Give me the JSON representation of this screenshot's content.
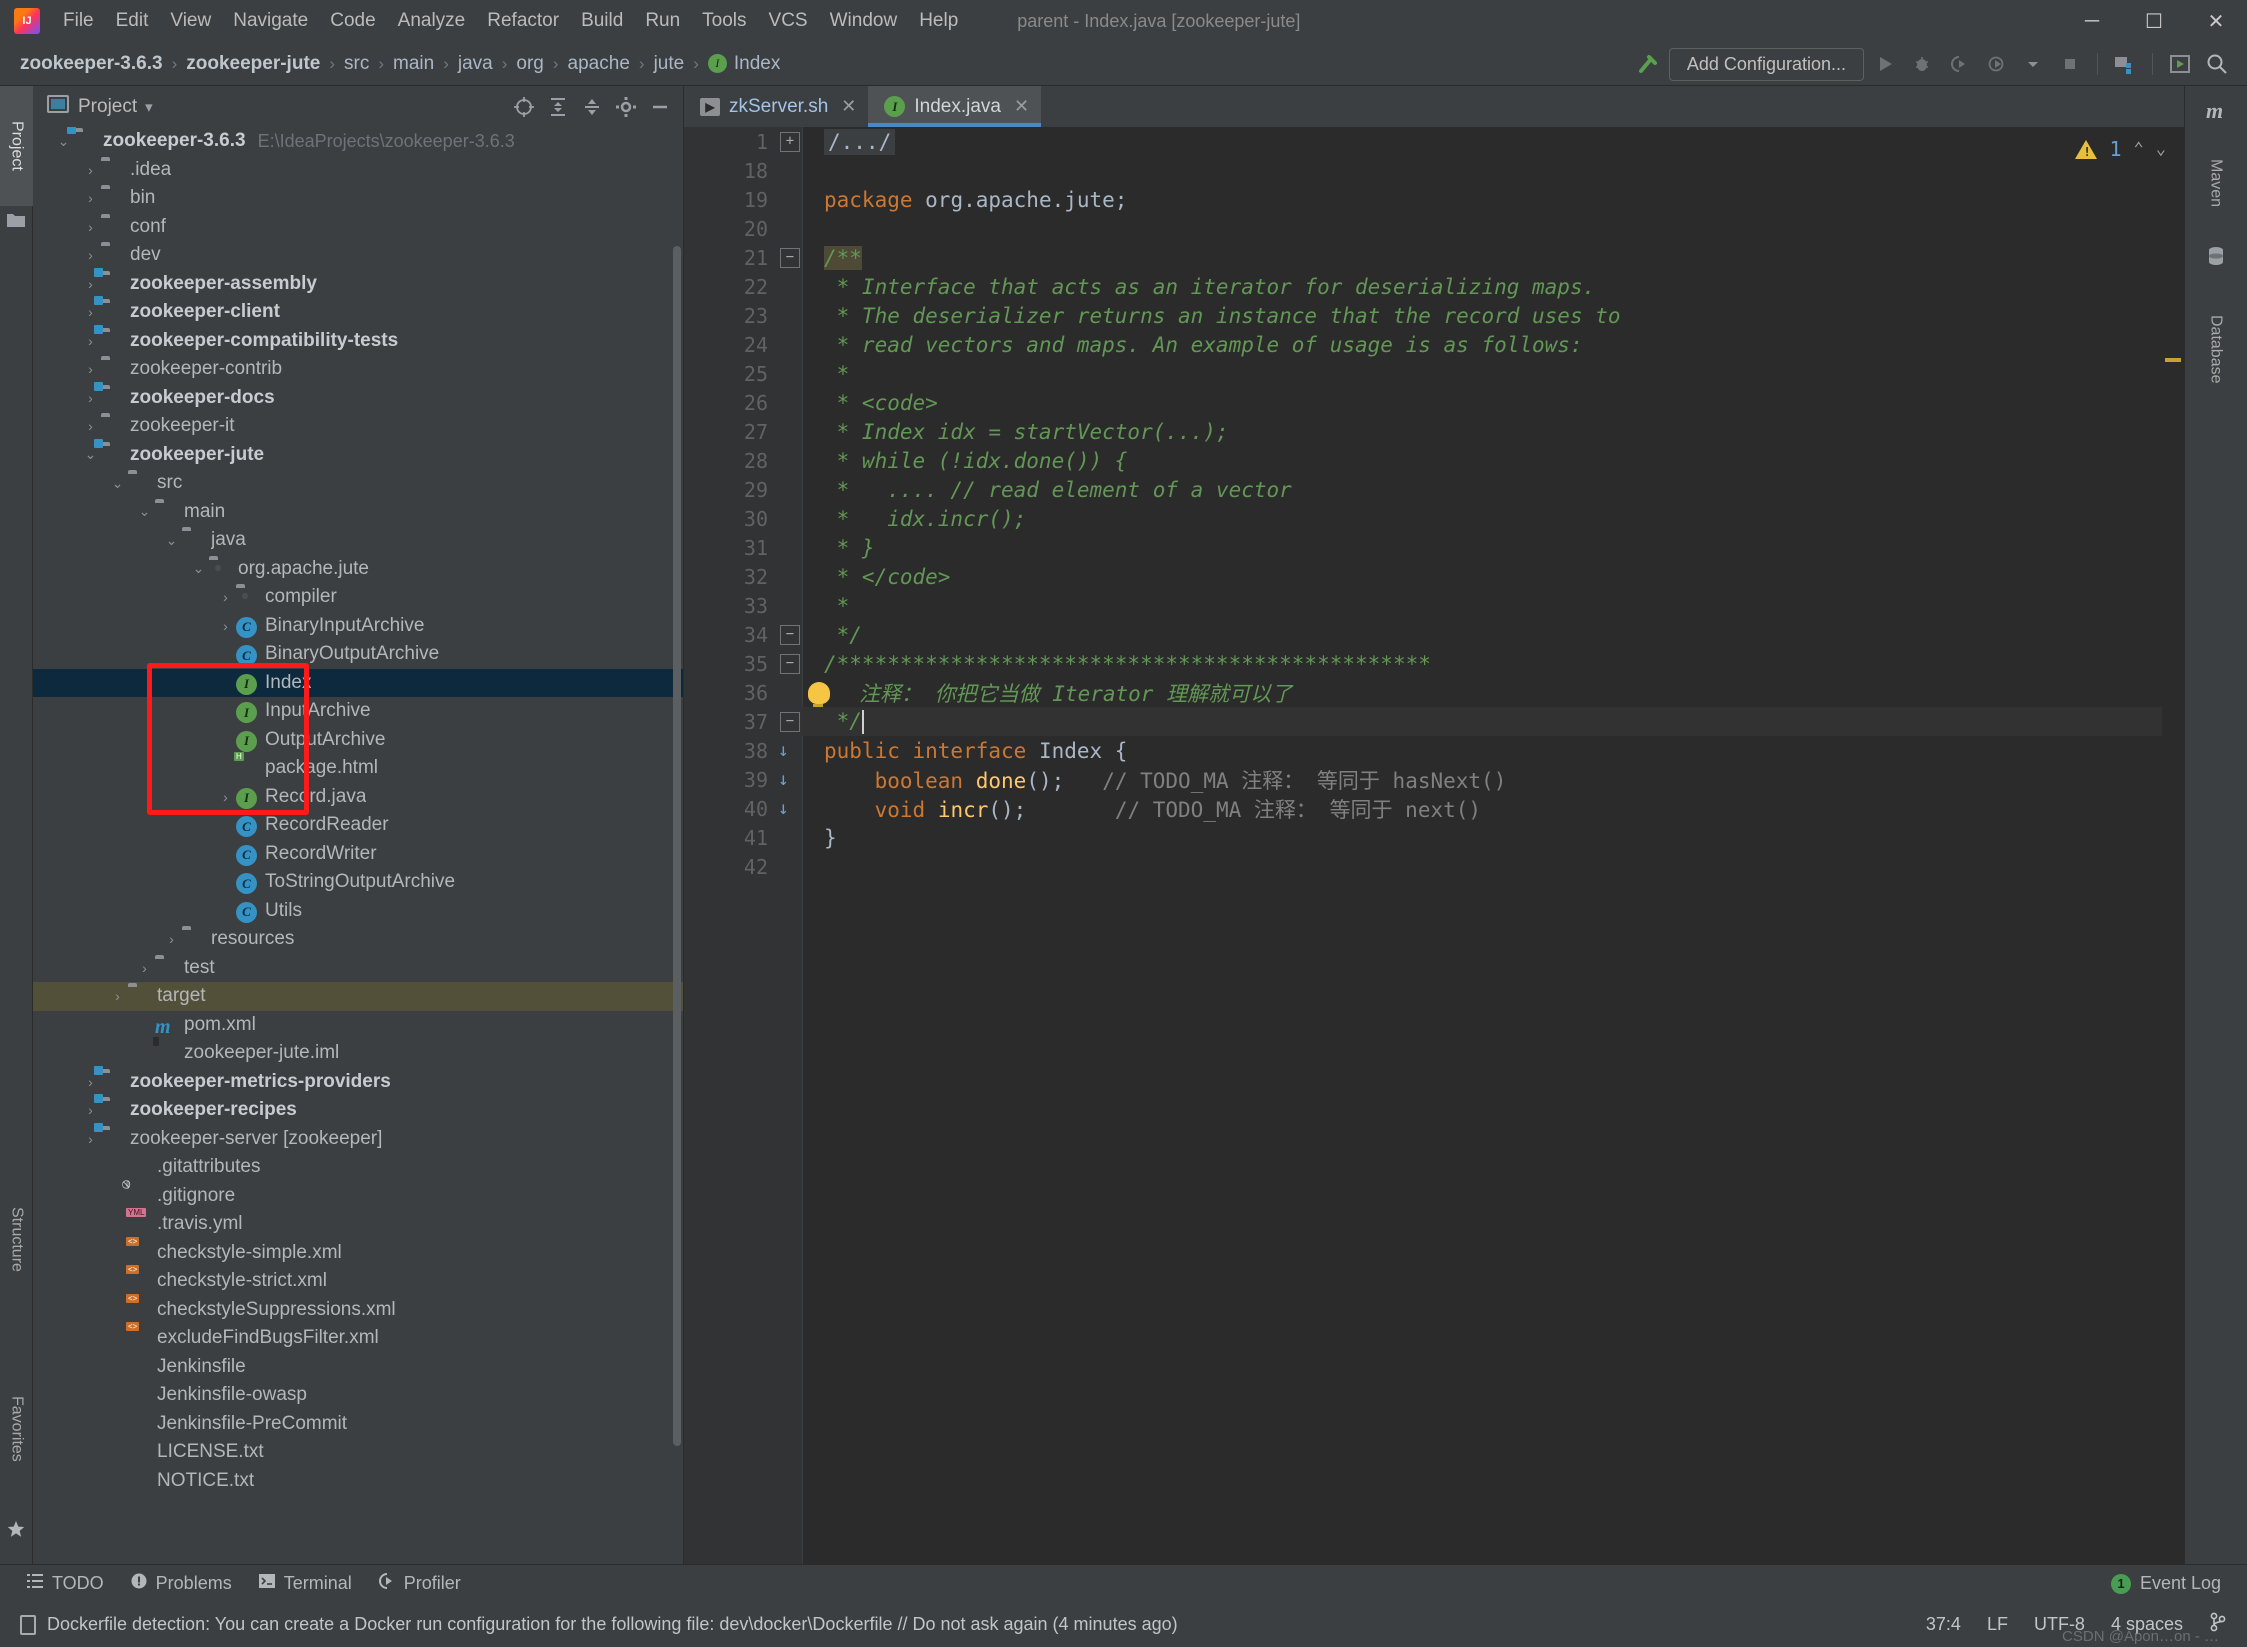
{
  "window": {
    "title": "parent - Index.java [zookeeper-jute]",
    "minimize": "─",
    "maximize": "☐",
    "close": "✕"
  },
  "menubar": {
    "items": [
      "File",
      "Edit",
      "View",
      "Navigate",
      "Code",
      "Analyze",
      "Refactor",
      "Build",
      "Run",
      "Tools",
      "VCS",
      "Window",
      "Help"
    ]
  },
  "breadcrumb": {
    "items": [
      {
        "label": "zookeeper-3.6.3",
        "bold": true,
        "icon": ""
      },
      {
        "label": "zookeeper-jute",
        "bold": true,
        "icon": ""
      },
      {
        "label": "src",
        "bold": false,
        "icon": ""
      },
      {
        "label": "main",
        "bold": false,
        "icon": ""
      },
      {
        "label": "java",
        "bold": false,
        "icon": ""
      },
      {
        "label": "org",
        "bold": false,
        "icon": ""
      },
      {
        "label": "apache",
        "bold": false,
        "icon": ""
      },
      {
        "label": "jute",
        "bold": false,
        "icon": ""
      },
      {
        "label": "Index",
        "bold": false,
        "icon": "interface-icon"
      }
    ],
    "separator": "›"
  },
  "toolbar": {
    "build_icon": "hammer-icon",
    "add_configuration": "Add Configuration...",
    "run_icon": "run-icon",
    "debug_icon": "debug-icon",
    "run_coverage_icon": "run-with-coverage-icon",
    "profile_icon": "profile-icon",
    "dropdown_icon": "chevron-down-icon",
    "stop_icon": "stop-icon",
    "project_structure_icon": "project-structure-icon",
    "update_icon": "update-icon",
    "search_icon": "search-icon"
  },
  "left_strip": {
    "tabs": [
      {
        "label": "Project",
        "selected": true,
        "icon": "project-icon"
      },
      {
        "label": "Structure",
        "selected": false,
        "icon": "structure-icon"
      },
      {
        "label": "Favorites",
        "selected": false,
        "icon": "star-icon"
      }
    ]
  },
  "right_strip": {
    "tabs": [
      {
        "label": "Maven",
        "icon": "maven-icon"
      },
      {
        "label": "Database",
        "icon": "database-icon"
      }
    ]
  },
  "project_panel": {
    "title": "Project",
    "title_dropdown": "▾",
    "header_icons": [
      "locate-icon",
      "expand-all-icon",
      "collapse-all-icon",
      "settings-gear-icon",
      "hide-icon"
    ],
    "tree": [
      {
        "depth": 0,
        "arrow": "down",
        "icon": "folder-module",
        "label": "zookeeper-3.6.3",
        "bold": true,
        "sub": "E:\\IdeaProjects\\zookeeper-3.6.3"
      },
      {
        "depth": 1,
        "arrow": "right",
        "icon": "folder",
        "label": ".idea",
        "bold": false
      },
      {
        "depth": 1,
        "arrow": "right",
        "icon": "folder",
        "label": "bin",
        "bold": false
      },
      {
        "depth": 1,
        "arrow": "right",
        "icon": "folder",
        "label": "conf",
        "bold": false
      },
      {
        "depth": 1,
        "arrow": "right",
        "icon": "folder",
        "label": "dev",
        "bold": false
      },
      {
        "depth": 1,
        "arrow": "right",
        "icon": "folder-module",
        "label": "zookeeper-assembly",
        "bold": true
      },
      {
        "depth": 1,
        "arrow": "right",
        "icon": "folder-module",
        "label": "zookeeper-client",
        "bold": true
      },
      {
        "depth": 1,
        "arrow": "right",
        "icon": "folder-module",
        "label": "zookeeper-compatibility-tests",
        "bold": true
      },
      {
        "depth": 1,
        "arrow": "right",
        "icon": "folder",
        "label": "zookeeper-contrib",
        "bold": false
      },
      {
        "depth": 1,
        "arrow": "right",
        "icon": "folder-module",
        "label": "zookeeper-docs",
        "bold": true
      },
      {
        "depth": 1,
        "arrow": "right",
        "icon": "folder",
        "label": "zookeeper-it",
        "bold": false
      },
      {
        "depth": 1,
        "arrow": "down",
        "icon": "folder-module",
        "label": "zookeeper-jute",
        "bold": true
      },
      {
        "depth": 2,
        "arrow": "down",
        "icon": "folder",
        "label": "src",
        "bold": false
      },
      {
        "depth": 3,
        "arrow": "down",
        "icon": "folder",
        "label": "main",
        "bold": false
      },
      {
        "depth": 4,
        "arrow": "down",
        "icon": "folder-source",
        "label": "java",
        "bold": false
      },
      {
        "depth": 5,
        "arrow": "down",
        "icon": "folder-package",
        "label": "org.apache.jute",
        "bold": false
      },
      {
        "depth": 6,
        "arrow": "right",
        "icon": "folder-package",
        "label": "compiler",
        "bold": false
      },
      {
        "depth": 6,
        "arrow": "right",
        "icon": "class-icon",
        "label": "BinaryInputArchive",
        "bold": false
      },
      {
        "depth": 6,
        "arrow": "none",
        "icon": "class-icon",
        "label": "BinaryOutputArchive",
        "bold": false
      },
      {
        "depth": 6,
        "arrow": "none",
        "icon": "interface-icon",
        "label": "Index",
        "bold": false,
        "selected": true
      },
      {
        "depth": 6,
        "arrow": "none",
        "icon": "interface-icon",
        "label": "InputArchive",
        "bold": false
      },
      {
        "depth": 6,
        "arrow": "none",
        "icon": "interface-icon",
        "label": "OutputArchive",
        "bold": false
      },
      {
        "depth": 6,
        "arrow": "none",
        "icon": "html-file-icon",
        "label": "package.html",
        "bold": false
      },
      {
        "depth": 6,
        "arrow": "right",
        "icon": "interface-icon",
        "label": "Record.java",
        "bold": false
      },
      {
        "depth": 6,
        "arrow": "none",
        "icon": "class-icon",
        "label": "RecordReader",
        "bold": false
      },
      {
        "depth": 6,
        "arrow": "none",
        "icon": "class-icon",
        "label": "RecordWriter",
        "bold": false
      },
      {
        "depth": 6,
        "arrow": "none",
        "icon": "class-icon",
        "label": "ToStringOutputArchive",
        "bold": false
      },
      {
        "depth": 6,
        "arrow": "none",
        "icon": "class-icon",
        "label": "Utils",
        "bold": false
      },
      {
        "depth": 4,
        "arrow": "right",
        "icon": "folder",
        "label": "resources",
        "bold": false
      },
      {
        "depth": 3,
        "arrow": "right",
        "icon": "folder",
        "label": "test",
        "bold": false
      },
      {
        "depth": 2,
        "arrow": "right",
        "icon": "folder-target",
        "label": "target",
        "bold": false,
        "highlight": true
      },
      {
        "depth": 3,
        "arrow": "none",
        "icon": "maven-file-icon",
        "label": "pom.xml",
        "bold": false
      },
      {
        "depth": 3,
        "arrow": "none",
        "icon": "iml-file-icon",
        "label": "zookeeper-jute.iml",
        "bold": false
      },
      {
        "depth": 1,
        "arrow": "right",
        "icon": "folder-module",
        "label": "zookeeper-metrics-providers",
        "bold": true
      },
      {
        "depth": 1,
        "arrow": "right",
        "icon": "folder-module",
        "label": "zookeeper-recipes",
        "bold": true
      },
      {
        "depth": 1,
        "arrow": "right",
        "icon": "folder-module",
        "label": "zookeeper-server [zookeeper]",
        "bold": false
      },
      {
        "depth": 2,
        "arrow": "none",
        "icon": "file-icon",
        "label": ".gitattributes",
        "bold": false
      },
      {
        "depth": 2,
        "arrow": "none",
        "icon": "gitignore-file-icon",
        "label": ".gitignore",
        "bold": false
      },
      {
        "depth": 2,
        "arrow": "none",
        "icon": "yml-file-icon",
        "label": ".travis.yml",
        "bold": false
      },
      {
        "depth": 2,
        "arrow": "none",
        "icon": "xml-file-icon",
        "label": "checkstyle-simple.xml",
        "bold": false
      },
      {
        "depth": 2,
        "arrow": "none",
        "icon": "xml-file-icon",
        "label": "checkstyle-strict.xml",
        "bold": false
      },
      {
        "depth": 2,
        "arrow": "none",
        "icon": "xml-file-icon",
        "label": "checkstyleSuppressions.xml",
        "bold": false
      },
      {
        "depth": 2,
        "arrow": "none",
        "icon": "xml-file-icon",
        "label": "excludeFindBugsFilter.xml",
        "bold": false
      },
      {
        "depth": 2,
        "arrow": "none",
        "icon": "file-icon",
        "label": "Jenkinsfile",
        "bold": false
      },
      {
        "depth": 2,
        "arrow": "none",
        "icon": "file-icon",
        "label": "Jenkinsfile-owasp",
        "bold": false
      },
      {
        "depth": 2,
        "arrow": "none",
        "icon": "file-icon",
        "label": "Jenkinsfile-PreCommit",
        "bold": false
      },
      {
        "depth": 2,
        "arrow": "none",
        "icon": "file-icon",
        "label": "LICENSE.txt",
        "bold": false
      },
      {
        "depth": 2,
        "arrow": "none",
        "icon": "file-icon",
        "label": "NOTICE.txt",
        "bold": false
      }
    ]
  },
  "editor": {
    "tabs": [
      {
        "label": "zkServer.sh",
        "icon": "shell-script-icon",
        "active": false,
        "closable": true
      },
      {
        "label": "Index.java",
        "icon": "interface-icon",
        "active": true,
        "closable": true
      }
    ],
    "close_glyph": "✕",
    "inspection": {
      "warning_count": "1",
      "up_glyph": "⌃",
      "down_glyph": "⌄"
    },
    "lines": [
      {
        "num": "1",
        "fold": "plus",
        "text": "/.../",
        "style": "folded"
      },
      {
        "num": "18",
        "fold": "",
        "text": "",
        "style": "plain"
      },
      {
        "num": "19",
        "fold": "",
        "text": "package org.apache.jute;",
        "style": "package"
      },
      {
        "num": "20",
        "fold": "",
        "text": "",
        "style": "plain"
      },
      {
        "num": "21",
        "fold": "minus-top",
        "text": "/**",
        "style": "comment-open"
      },
      {
        "num": "22",
        "fold": "",
        "text": " * Interface that acts as an iterator for deserializing maps.",
        "style": "comment"
      },
      {
        "num": "23",
        "fold": "",
        "text": " * The deserializer returns an instance that the record uses to",
        "style": "comment"
      },
      {
        "num": "24",
        "fold": "",
        "text": " * read vectors and maps. An example of usage is as follows:",
        "style": "comment"
      },
      {
        "num": "25",
        "fold": "",
        "text": " *",
        "style": "comment"
      },
      {
        "num": "26",
        "fold": "",
        "text": " * <code>",
        "style": "comment"
      },
      {
        "num": "27",
        "fold": "",
        "text": " * Index idx = startVector(...);",
        "style": "comment"
      },
      {
        "num": "28",
        "fold": "",
        "text": " * while (!idx.done()) {",
        "style": "comment"
      },
      {
        "num": "29",
        "fold": "",
        "text": " *   .... // read element of a vector",
        "style": "comment"
      },
      {
        "num": "30",
        "fold": "",
        "text": " *   idx.incr();",
        "style": "comment"
      },
      {
        "num": "31",
        "fold": "",
        "text": " * }",
        "style": "comment"
      },
      {
        "num": "32",
        "fold": "",
        "text": " * </code>",
        "style": "comment"
      },
      {
        "num": "33",
        "fold": "",
        "text": " *",
        "style": "comment"
      },
      {
        "num": "34",
        "fold": "minus-bottom",
        "text": " */",
        "style": "comment"
      },
      {
        "num": "35",
        "fold": "minus-top",
        "text": "/***********************************************",
        "style": "comment"
      },
      {
        "num": "36",
        "fold": "",
        "text": "注释： 你把它当做 Iterator 理解就可以了",
        "style": "comment-cjk",
        "bulb": true
      },
      {
        "num": "37",
        "fold": "minus-bottom",
        "text": " */",
        "style": "comment",
        "caret": true,
        "current": true
      },
      {
        "num": "38",
        "fold": "",
        "text": "public interface Index {",
        "style": "decl",
        "gutter_mark": "impl"
      },
      {
        "num": "39",
        "fold": "",
        "text": "    boolean done();   // TODO_MA 注释： 等同于 hasNext()",
        "style": "method1",
        "gutter_mark": "impl"
      },
      {
        "num": "40",
        "fold": "",
        "text": "    void incr();       // TODO_MA 注释： 等同于 next()",
        "style": "method2",
        "gutter_mark": "impl"
      },
      {
        "num": "41",
        "fold": "",
        "text": "}",
        "style": "plain"
      },
      {
        "num": "42",
        "fold": "",
        "text": "",
        "style": "plain"
      }
    ]
  },
  "bottom_toolwindows": [
    {
      "label": "TODO",
      "icon": "todo-icon"
    },
    {
      "label": "Problems",
      "icon": "problems-icon"
    },
    {
      "label": "Terminal",
      "icon": "terminal-icon"
    },
    {
      "label": "Profiler",
      "icon": "profiler-icon"
    }
  ],
  "event_log": {
    "count": "1",
    "label": "Event Log"
  },
  "statusbar": {
    "message": "Dockerfile detection: You can create a Docker run configuration for the following file: dev\\docker\\Dockerfile // Do not ask again (4 minutes ago)",
    "caret_position": "37:4",
    "line_separator": "LF",
    "encoding": "UTF-8",
    "indent": "4 spaces",
    "branch_icon": "git-branch-icon",
    "watermark": "CSDN @Apon…on - …"
  },
  "colors": {
    "accent_blue": "#4a88c7",
    "selection": "#0d293e",
    "highlight_row": "#53503a",
    "comment_green": "#629755",
    "keyword_orange": "#cc7832",
    "annotation_red": "#ff1a1a"
  }
}
